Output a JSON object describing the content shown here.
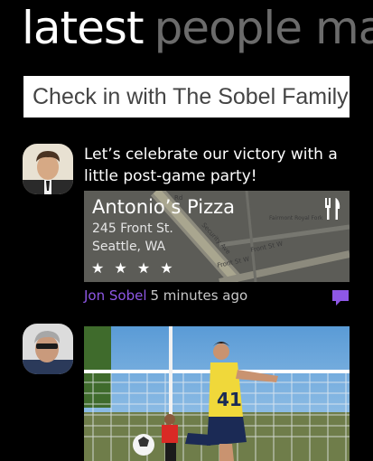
{
  "pivot": {
    "active": "latest",
    "next": "people ma"
  },
  "checkin": {
    "placeholder": "Check in with The Sobel Family"
  },
  "feed": [
    {
      "text": "Let’s celebrate our victory with a little post-game party!",
      "place": {
        "name": "Antonio’s Pizza",
        "address_line1": "245 Front St.",
        "address_line2": "Seattle, WA",
        "rating_stars": 4,
        "rating_max": 5,
        "rating_display": "★ ★ ★ ★",
        "map_labels": [
          "Rd",
          "Security Ave",
          "Fairmont Royal Fork",
          "Front St W",
          "Front St W"
        ]
      },
      "author": "Jon Sobel",
      "time": "5 minutes ago"
    },
    {
      "photo_jersey_number": "41"
    }
  ],
  "colors": {
    "accent": "#8e57e6",
    "background": "#000000"
  }
}
